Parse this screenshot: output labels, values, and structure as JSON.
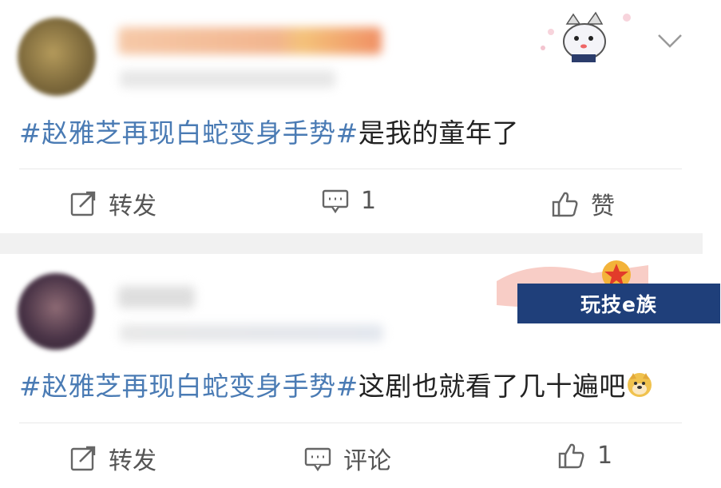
{
  "posts": [
    {
      "hashtag": "#赵雅芝再现白蛇变身手势#",
      "text": "是我的童年了",
      "actions": {
        "repost_label": "转发",
        "comment_label": "1",
        "like_label": "赞"
      }
    },
    {
      "hashtag": "#赵雅芝再现白蛇变身手势#",
      "text": "这剧也就看了几十遍吧",
      "actions": {
        "repost_label": "转发",
        "comment_label": "评论",
        "like_label": "1"
      }
    }
  ],
  "watermark": {
    "text": "玩技e族"
  },
  "icons": {
    "repost": "edit-share-icon",
    "comment": "comment-bubble-icon",
    "like": "thumbs-up-icon",
    "expand": "chevron-down-icon",
    "emoji": "doge-emoji-icon"
  },
  "colors": {
    "hashtag": "#4a7bb4",
    "watermark_bg": "#1f3f7a",
    "separator": "#f1f1f1"
  }
}
